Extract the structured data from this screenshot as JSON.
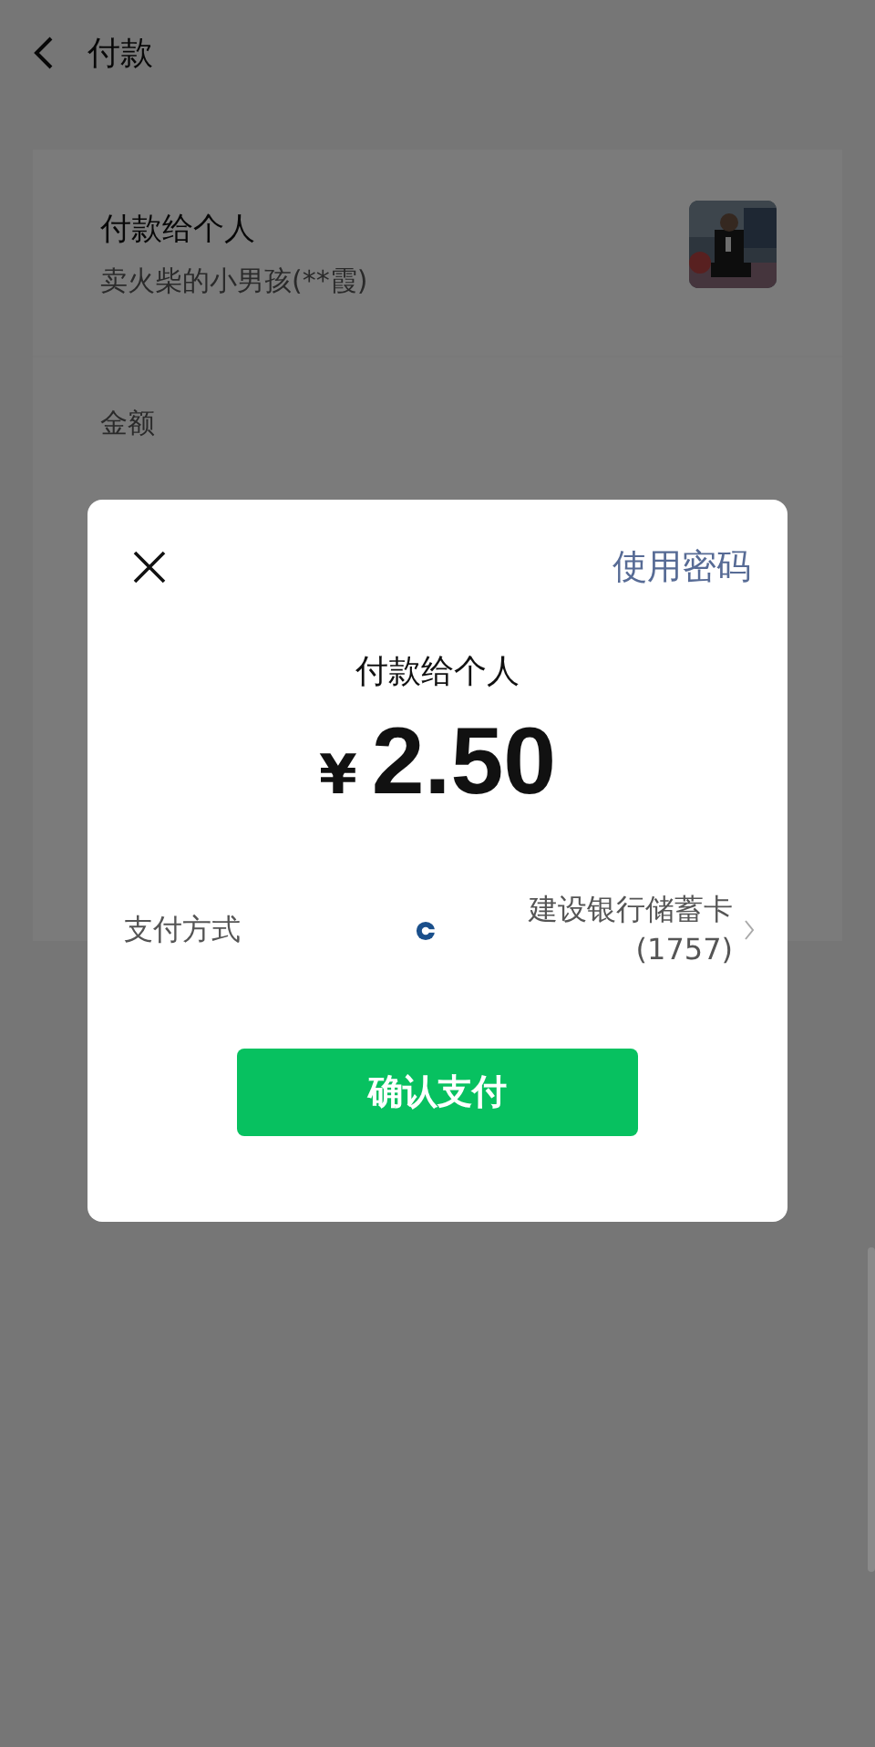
{
  "header": {
    "title": "付款"
  },
  "recipient": {
    "label": "付款给个人",
    "name": "卖火柴的小男孩(**霞)"
  },
  "amount_section": {
    "label": "金额"
  },
  "dialog": {
    "use_password": "使用密码",
    "title": "付款给个人",
    "currency": "¥",
    "amount": "2.50",
    "payment_method_label": "支付方式",
    "payment_method_value": "建设银行储蓄卡(1757)",
    "confirm_button": "确认支付"
  }
}
